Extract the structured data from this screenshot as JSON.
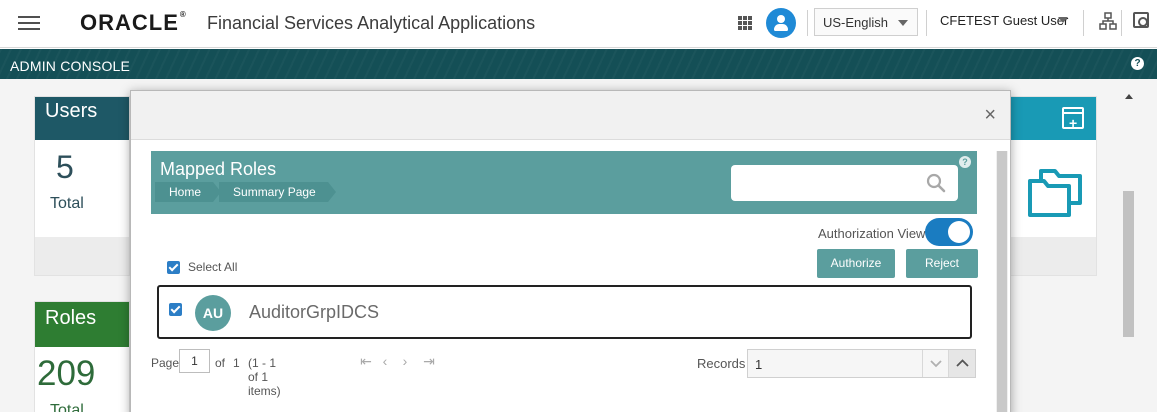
{
  "header": {
    "brand": "ORACLE",
    "trademark": "®",
    "app_title": "Financial Services Analytical Applications",
    "language": "US-English",
    "username": "CFETEST Guest User",
    "icons": [
      "hamburger-menu-icon",
      "apps-grid-icon",
      "user-admin-icon",
      "hierarchy-icon",
      "screenshot-icon"
    ]
  },
  "admin_bar": {
    "title": "ADMIN CONSOLE",
    "help": "?"
  },
  "background": {
    "users_card": {
      "title": "Users",
      "count": "5",
      "label": "Total"
    },
    "roles_card": {
      "title": "Roles",
      "count": "209",
      "label": "Total"
    }
  },
  "modal": {
    "close": "×",
    "title": "Mapped Roles",
    "help": "?",
    "breadcrumbs": [
      "Home",
      "Summary Page"
    ],
    "search": {
      "value": "",
      "placeholder": ""
    },
    "authorization_view_label": "Authorization View",
    "authorization_view_on": true,
    "select_all_label": "Select All",
    "buttons": {
      "authorize": "Authorize",
      "reject": "Reject"
    },
    "rows": [
      {
        "initials": "AU",
        "name": "AuditorGrpIDCS",
        "checked": true
      }
    ],
    "pagination": {
      "page_label": "Page",
      "page": "1",
      "of_label": "of",
      "total_pages": "1",
      "items_text": "(1 - 1 of 1 items)",
      "records_label": "Records",
      "records_value": "1"
    }
  },
  "colors": {
    "admin_bar": "#144f56",
    "banner": "#5b9e9e",
    "users_header": "#1e5866",
    "roles_header": "#2e7d32",
    "toggle_on": "#1a7cc1",
    "accent_blue": "#1f8ad6"
  }
}
